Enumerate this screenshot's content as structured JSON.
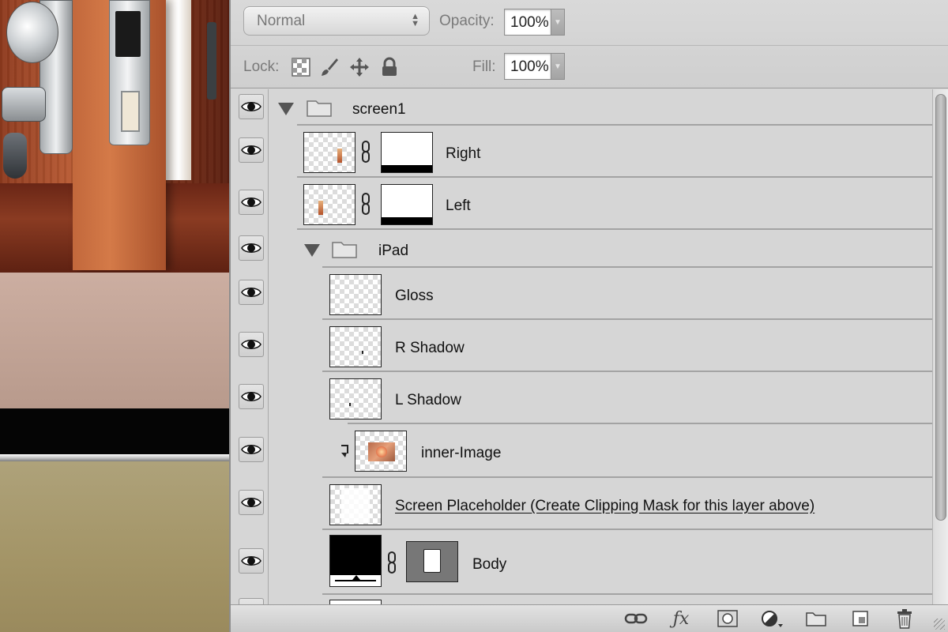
{
  "toolbar": {
    "blend_mode": "Normal",
    "opacity_label": "Opacity:",
    "opacity_value": "100%",
    "lock_label": "Lock:",
    "fill_label": "Fill:",
    "fill_value": "100%"
  },
  "layers": [
    {
      "name": "screen1",
      "type": "group",
      "expanded": true
    },
    {
      "name": "Right",
      "type": "layer-with-mask"
    },
    {
      "name": "Left",
      "type": "layer-with-mask"
    },
    {
      "name": "iPad",
      "type": "group",
      "expanded": true
    },
    {
      "name": "Gloss",
      "type": "layer"
    },
    {
      "name": "R Shadow",
      "type": "layer"
    },
    {
      "name": "L Shadow",
      "type": "layer"
    },
    {
      "name": "inner-Image",
      "type": "clipped-layer"
    },
    {
      "name": "Screen Placeholder (Create Clipping Mask for this layer above)",
      "type": "layer"
    },
    {
      "name": "Body",
      "type": "layer-with-mask"
    }
  ],
  "icons": {
    "visibility": "eye-icon",
    "group": "folder-icon",
    "expand": "triangle-down-icon",
    "mask_link": "chain-link-icon",
    "clipping": "clipping-arrow-icon",
    "bottom_bar": [
      "link-layers-icon",
      "fx-icon",
      "add-mask-icon",
      "adjustment-layer-icon",
      "new-group-icon",
      "new-layer-icon",
      "trash-icon"
    ]
  },
  "colors": {
    "panel_bg": "#d6d6d6",
    "field_bg": "#ffffff"
  }
}
